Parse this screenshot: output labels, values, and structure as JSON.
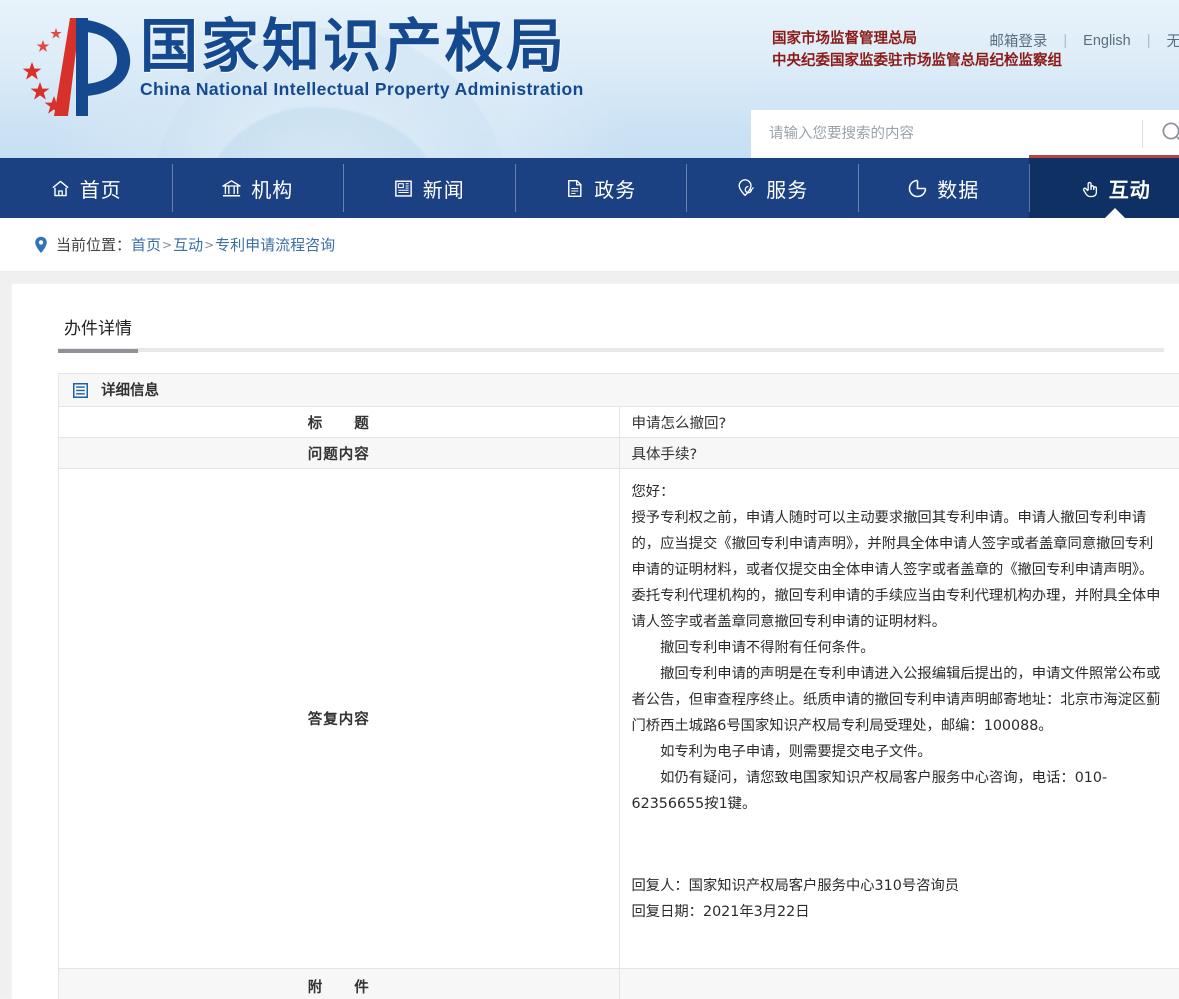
{
  "header": {
    "logo_cn": "国家知识产权局",
    "logo_en": "China National Intellectual Property Administration",
    "top_links": [
      {
        "label": "邮箱登录"
      },
      {
        "label": "English"
      },
      {
        "label": "无"
      }
    ],
    "org_line1": "国家市场监督管理总局",
    "org_line2": "中央纪委国家监委驻市场监管总局纪检监察组",
    "search": {
      "placeholder": "请输入您要搜索的内容",
      "value": "",
      "button_icon": "search-icon"
    }
  },
  "nav": {
    "items": [
      {
        "label": "首页",
        "icon": "home-icon",
        "active": false
      },
      {
        "label": "机构",
        "icon": "bank-icon",
        "active": false
      },
      {
        "label": "新闻",
        "icon": "newspaper-icon",
        "active": false
      },
      {
        "label": "政务",
        "icon": "document-icon",
        "active": false
      },
      {
        "label": "服务",
        "icon": "shield-check-icon",
        "active": false
      },
      {
        "label": "数据",
        "icon": "pie-chart-icon",
        "active": false
      },
      {
        "label": "互动",
        "icon": "hand-pointer-icon",
        "active": true
      }
    ]
  },
  "breadcrumb": {
    "prefix": "当前位置：",
    "items": [
      "首页",
      "互动",
      "专利申请流程咨询"
    ],
    "separator": ">"
  },
  "main": {
    "tabs": [
      {
        "label": "办件详情",
        "active": true
      }
    ],
    "section_title": "详细信息",
    "rows": {
      "title_label": "标　　题",
      "title_value": "申请怎么撤回?",
      "question_label": "问题内容",
      "question_value": "具体手续?",
      "reply_label": "答复内容",
      "attachment_label": "附　　件",
      "attachment_value": ""
    },
    "reply": {
      "greeting": "您好：",
      "para1": "授予专利权之前，申请人随时可以主动要求撤回其专利申请。申请人撤回专利申请的，应当提交《撤回专利申请声明》，并附具全体申请人签字或者盖章同意撤回专利申请的证明材料，或者仅提交由全体申请人签字或者盖章的《撤回专利申请声明》。委托专利代理机构的，撤回专利申请的手续应当由专利代理机构办理，并附具全体申请人签字或者盖章同意撤回专利申请的证明材料。",
      "para2": "撤回专利申请不得附有任何条件。",
      "para3": "撤回专利申请的声明是在专利申请进入公报编辑后提出的，申请文件照常公布或者公告，但审查程序终止。纸质申请的撤回专利申请声明邮寄地址：北京市海淀区蓟门桥西土城路6号国家知识产权局专利局受理处，邮编：100088。",
      "para4": "如专利为电子申请，则需要提交电子文件。",
      "para5": "如仍有疑问，请您致电国家知识产权局客户服务中心咨询，电话：010-62356655按1键。",
      "replier": "回复人：国家知识产权局客户服务中心310号咨询员",
      "reply_date": "回复日期：2021年3月22日"
    }
  },
  "colors": {
    "nav_blue": "#1b4183",
    "nav_active": "#0f3063",
    "accent_red": "#b8453e",
    "logo_blue": "#15498f",
    "org_red": "#8b1a16",
    "link_blue": "#3b6ea5"
  }
}
